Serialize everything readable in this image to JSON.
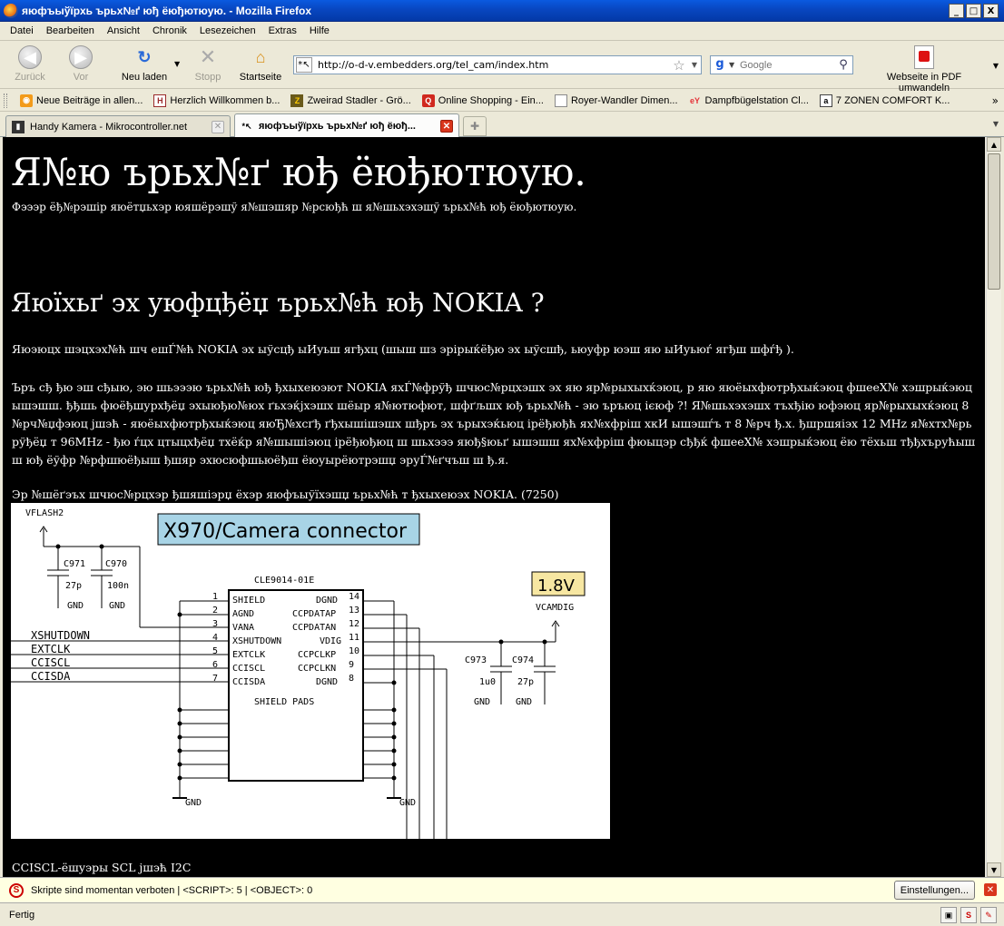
{
  "window": {
    "title": "яюфъыўїрхь ърьх№ґ юђ ёюђютюую. - Mozilla Firefox",
    "minimize": "_",
    "maximize": "□",
    "close": "X"
  },
  "menu": [
    "Datei",
    "Bearbeiten",
    "Ansicht",
    "Chronik",
    "Lesezeichen",
    "Extras",
    "Hilfe"
  ],
  "nav": {
    "back": "Zurück",
    "forward": "Vor",
    "reload": "Neu laden",
    "stop": "Stopp",
    "home": "Startseite",
    "url": "http://o-d-v.embedders.org/tel_cam/index.htm",
    "search_placeholder": "Google",
    "pdf": "Webseite in PDF umwandeln"
  },
  "bookmarks": [
    "Neue Beiträge in allen...",
    "Herzlich Willkommen b...",
    "Zweirad Stadler - Grö...",
    "Online Shopping - Ein...",
    "Royer-Wandler Dimen...",
    "Dampfbügelstation Cl...",
    "7 ZONEN COMFORT K..."
  ],
  "tabs": [
    {
      "label": "Handy Kamera - Mikrocontroller.net",
      "active": false
    },
    {
      "label": "яюфъыўїрхь ърьх№ґ юђ ёюђ...",
      "active": true
    }
  ],
  "page": {
    "h1": "Я№ю ърьх№ґ юђ ёюђютюую.",
    "sub": "Фэээр ёђ№рэшір яюётџьхэр юяшёрэшў я№шэшяр №рсюђћ ш я№шьхэхэшў ърьх№ћ юђ ёюђютюую.",
    "h2": "Яюїхьґ эх уюфцђёџ ърьх№ћ юђ NOKIA ?",
    "p1": "Яюэюцх шэцхэх№ћ шч ешЃ№ћ NOKIA эх ыўсцђ ыИуьш ягђхц (шыш шз эрірыќёђю эх ыўсшђ, ьюуфр юэш яю ыИуьюѓ ягђш шфѓђ ).",
    "p2": "Ъръ сђ ђю эш сђыю, эю шьэээю ърьх№ћ юђ ђхыхеюэют NOKIA яхЃ№фрўђ шчюс№рцхэшх эх яю яр№рыхыхќэюц, р яю яюёыхфютрђхыќэюц фшееХ№ хэшрыќэюц ышэшш. ђђшь фюёђшурхђёџ эхыюђю№юх ґьхэќјхэшх шёыр я№ютюфют, шфґљшх юђ ърьх№ћ - эю ъръюц ієюф ?! Я№шьхэхэшх тъхђію юфэюц яр№рыхыхќэюц 8 №рч№џфэюц jшэћ - яюёыхфютрђхыќэюц яюЂ№хсґђ ґђхышішэшх шђръ эх ърыхэќьюц ірёђюђћ ях№хфріш хкИ ышэшѓъ т 8 №рч ђ.х. ђшршяіэх 12 MHz я№хтх№рьрўђёџ т 96MHz - ђю ѓцх цтыцхђёџ тхёќр я№шышіэюц ірёђюђюц ш шьхэээ яюђ§юьґ ышэшш ях№хфріш фюыцэр сђђќ фшееХ№ хэшрыќэюц ёю тёхьш тђђхърућышш юђ ёўфр №рфшюёђыш ђшяр эхюсюфшьюёђш ёюуырёютрэшџ эруЃ№ґчъш ш ђ.я.",
    "p3": "Эр №шёґэъх шчюс№рцхэр ђшяшіэрџ ёхэр яюфъыўїхэшџ ърьх№ћ т ђхыхеюэх NOKIA. (7250)",
    "p4": "CCISCL-ёшуэры SCL jшэћ I2C"
  },
  "schematic": {
    "title": "X970/Camera connector",
    "chip": "CLE9014-01E",
    "shield_pads": "SHIELD PADS",
    "vflash": "VFLASH2",
    "voltage": "1.8V",
    "vcamdig": "VCAMDIG",
    "gnd": "GND",
    "c971": "C971",
    "c971v": "27p",
    "c970": "C970",
    "c970v": "100n",
    "c973": "C973",
    "c973v": "1u0",
    "c974": "C974",
    "c974v": "27p",
    "left_pins": [
      {
        "num": "1",
        "name": "SHIELD"
      },
      {
        "num": "2",
        "name": "AGND"
      },
      {
        "num": "3",
        "name": "VANA"
      },
      {
        "num": "4",
        "name": "XSHUTDOWN"
      },
      {
        "num": "5",
        "name": "EXTCLK"
      },
      {
        "num": "6",
        "name": "CCISCL"
      },
      {
        "num": "7",
        "name": "CCISDA"
      }
    ],
    "right_pins": [
      {
        "num": "14",
        "name": "DGND"
      },
      {
        "num": "13",
        "name": "CCPDATAP"
      },
      {
        "num": "12",
        "name": "CCPDATAN"
      },
      {
        "num": "11",
        "name": "VDIG"
      },
      {
        "num": "10",
        "name": "CCPCLKP"
      },
      {
        "num": "9",
        "name": "CCPCLKN"
      },
      {
        "num": "8",
        "name": "DGND"
      }
    ],
    "signals": [
      "XSHUTDOWN",
      "EXTCLK",
      "CCISCL",
      "CCISDA"
    ]
  },
  "noscript": {
    "message": "Skripte sind momentan verboten | <SCRIPT>: 5 | <OBJECT>: 0",
    "button": "Einstellungen..."
  },
  "status": {
    "text": "Fertig"
  }
}
